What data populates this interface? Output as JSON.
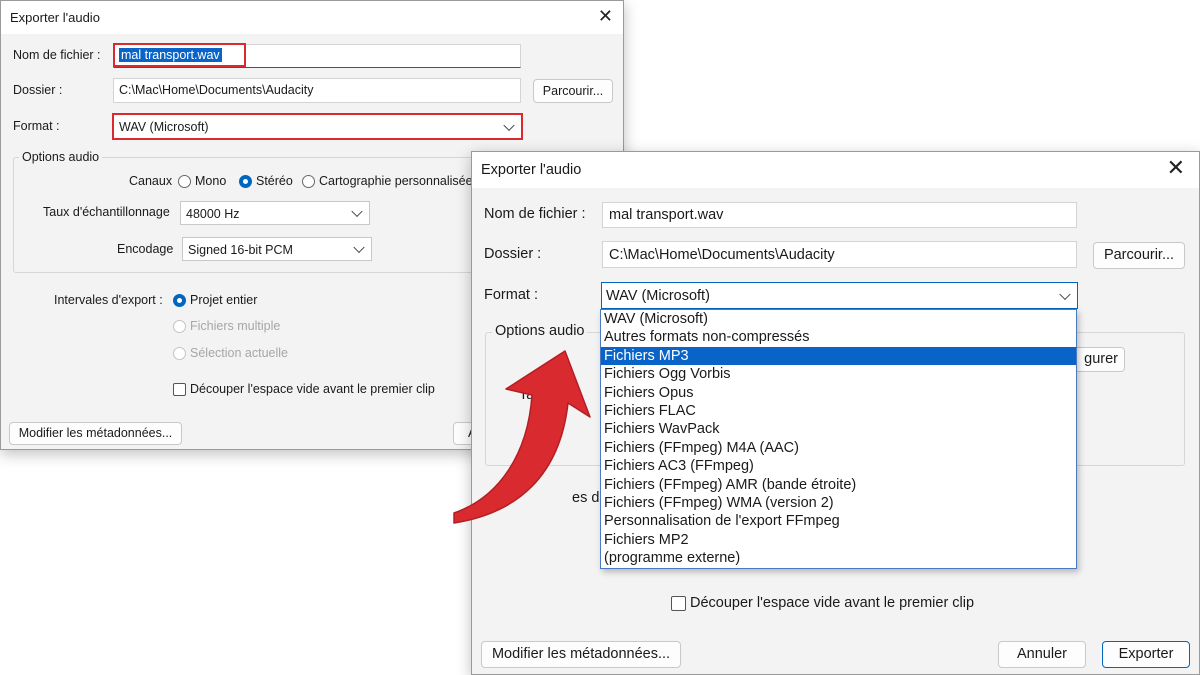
{
  "dialog_back": {
    "title": "Exporter l'audio",
    "close_glyph": "✕",
    "filename_label": "Nom de fichier :",
    "filename_value": "mal transport.wav",
    "folder_label": "Dossier :",
    "folder_value": "C:\\Mac\\Home\\Documents\\Audacity",
    "browse_label": "Parcourir...",
    "format_label": "Format :",
    "format_value": "WAV (Microsoft)",
    "audio_options_legend": "Options audio",
    "channels_label": "Canaux",
    "channel_mono": "Mono",
    "channel_stereo": "Stéréo",
    "channel_custom": "Cartographie personnalisée",
    "sample_rate_label": "Taux d'échantillonnage",
    "sample_rate_value": "48000 Hz",
    "encoding_label": "Encodage",
    "encoding_value": "Signed 16-bit PCM",
    "range_label": "Intervales d'export :",
    "range_full": "Projet entier",
    "range_multi": "Fichiers multiple",
    "range_selection": "Sélection actuelle",
    "trim_label": "Découper l'espace vide avant le premier clip",
    "metadata_button": "Modifier les métadonnées...",
    "partial_button": "A"
  },
  "dialog_front": {
    "title": "Exporter l'audio",
    "close_glyph": "✕",
    "filename_label": "Nom de fichier :",
    "filename_value": "mal transport.wav",
    "folder_label": "Dossier :",
    "folder_value": "C:\\Mac\\Home\\Documents\\Audacity",
    "browse_label": "Parcourir...",
    "format_label": "Format :",
    "format_value": "WAV (Microsoft)",
    "audio_options_legend": "Options audio",
    "configure_partial": "gurer",
    "partial_label_a": "Tau",
    "partial_label_b": "es d",
    "trim_label": "Découper l'espace vide avant le premier clip",
    "metadata_button": "Modifier les métadonnées...",
    "cancel_button": "Annuler",
    "export_button": "Exporter"
  },
  "format_dropdown": {
    "selected_index": 2,
    "items": [
      "WAV (Microsoft)",
      "Autres formats non-compressés",
      "Fichiers MP3",
      "Fichiers Ogg Vorbis",
      "Fichiers Opus",
      "Fichiers FLAC",
      "Fichiers WavPack",
      "Fichiers (FFmpeg) M4A (AAC)",
      "Fichiers AC3 (FFmpeg)",
      "Fichiers (FFmpeg) AMR (bande étroite)",
      "Fichiers (FFmpeg) WMA (version 2)",
      "Personnalisation de l'export FFmpeg",
      "Fichiers MP2",
      "(programme externe)"
    ]
  },
  "colors": {
    "highlight": "#0a64c8",
    "annotation_red": "#d92a2f",
    "dialog_bg": "#f3f3f3"
  },
  "icons": {
    "close": "close-icon",
    "chevron": "chevron-down-icon",
    "arrow": "curved-arrow-icon"
  }
}
